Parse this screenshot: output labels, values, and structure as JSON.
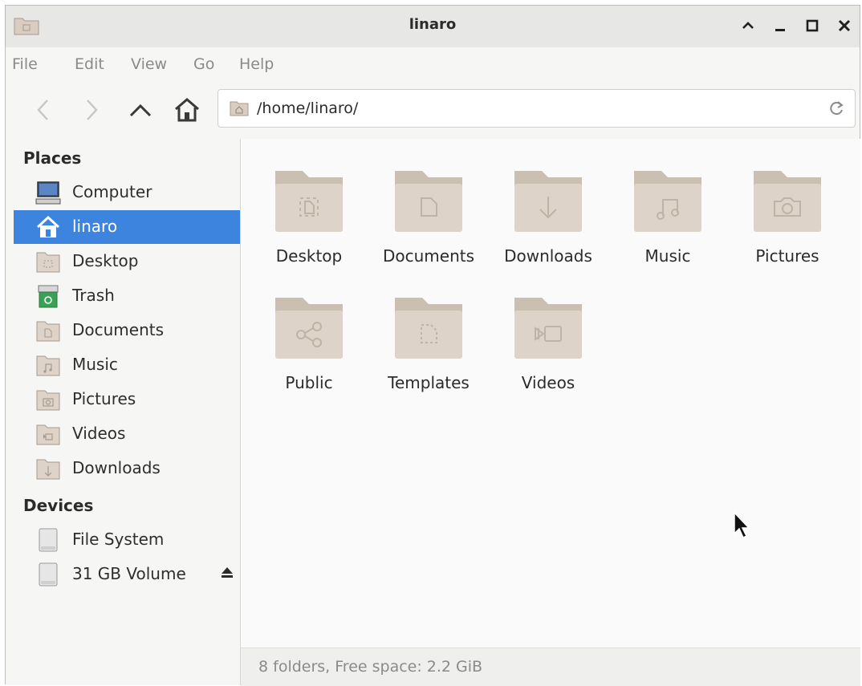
{
  "window": {
    "title": "linaro",
    "controls": [
      "maximize-up",
      "minimize",
      "maximize",
      "close"
    ]
  },
  "menu": [
    "File",
    "Edit",
    "View",
    "Go",
    "Help"
  ],
  "toolbar": {
    "path": "/home/linaro/"
  },
  "sidebar": {
    "places_header": "Places",
    "places": [
      {
        "label": "Computer",
        "icon": "computer-icon",
        "selected": false
      },
      {
        "label": "linaro",
        "icon": "home-icon",
        "selected": true
      },
      {
        "label": "Desktop",
        "icon": "desktop-folder-icon",
        "selected": false
      },
      {
        "label": "Trash",
        "icon": "trash-icon",
        "selected": false
      },
      {
        "label": "Documents",
        "icon": "documents-folder-icon",
        "selected": false
      },
      {
        "label": "Music",
        "icon": "music-folder-icon",
        "selected": false
      },
      {
        "label": "Pictures",
        "icon": "pictures-folder-icon",
        "selected": false
      },
      {
        "label": "Videos",
        "icon": "videos-folder-icon",
        "selected": false
      },
      {
        "label": "Downloads",
        "icon": "downloads-folder-icon",
        "selected": false
      }
    ],
    "devices_header": "Devices",
    "devices": [
      {
        "label": "File System",
        "icon": "drive-icon"
      },
      {
        "label": "31 GB Volume",
        "icon": "drive-icon",
        "ejectable": true
      }
    ]
  },
  "folders": [
    {
      "label": "Desktop",
      "glyph": "desktop"
    },
    {
      "label": "Documents",
      "glyph": "document"
    },
    {
      "label": "Downloads",
      "glyph": "download"
    },
    {
      "label": "Music",
      "glyph": "music"
    },
    {
      "label": "Pictures",
      "glyph": "camera"
    },
    {
      "label": "Public",
      "glyph": "share"
    },
    {
      "label": "Templates",
      "glyph": "template"
    },
    {
      "label": "Videos",
      "glyph": "video"
    }
  ],
  "status": "8 folders, Free space: 2.2 GiB",
  "colors": {
    "accent": "#3d84de",
    "folder": "#ddd3c8",
    "folder_tab": "#cbbfb2"
  }
}
